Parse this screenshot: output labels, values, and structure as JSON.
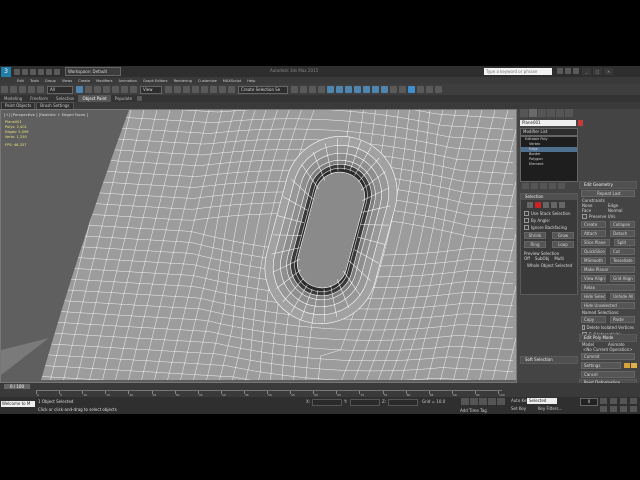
{
  "window": {
    "workspace": "Workspace: Default",
    "title": "Autodesk 3ds Max 2015",
    "help_search": "Type a keyword or phrase"
  },
  "menu": [
    "Edit",
    "Tools",
    "Group",
    "Views",
    "Create",
    "Modifiers",
    "Animation",
    "Graph Editors",
    "Rendering",
    "Customize",
    "MAXScript",
    "Help"
  ],
  "toolbar": {
    "selection_filter": "All",
    "coord_system": "View",
    "named_selection": "Create Selection Se"
  },
  "ribbon": {
    "tabs": [
      "Modeling",
      "Freeform",
      "Selection",
      "Object Paint",
      "Populate"
    ],
    "active_tab": "Object Paint",
    "sub": [
      "Paint Objects",
      "Brush Settings"
    ]
  },
  "viewport": {
    "label": "[+] [Perspective ] [Realistic + Edged Faces ]",
    "stats": {
      "header": "Plane001",
      "polys_label": "Polys:",
      "polys": "2,401",
      "edges_label": "Edges:",
      "edges": "5,096",
      "verts_label": "Verts:",
      "verts": "1,250",
      "fps_label": "FPS:",
      "fps": "46.337"
    }
  },
  "command_panel": {
    "object_name": "Plane001",
    "modifier_list": "Modifier List",
    "stack": [
      "Editable Poly",
      "Vertex",
      "Edge",
      "Border",
      "Polygon",
      "Element"
    ],
    "stack_selected": "Edge",
    "selection": {
      "title": "Selection",
      "by_vertex": "Use Stack Selection",
      "by_angle": "By Angle:",
      "ignore": "Ignore Backfacing",
      "shrink": "Shrink",
      "grow": "Grow",
      "ring": "Ring",
      "loop": "Loop",
      "preview": "Preview Selection",
      "off": "Off",
      "subobj": "SubObj",
      "multi": "Multi",
      "whole": "Whole Object Selected"
    },
    "soft_selection": "Soft Selection",
    "edit_geometry": {
      "title": "Edit Geometry",
      "repeat": "Repeat Last",
      "constraints": "Constraints",
      "none": "None",
      "edge": "Edge",
      "face": "Face",
      "normal": "Normal",
      "preserve": "Preserve UVs",
      "create": "Create",
      "collapse": "Collapse",
      "attach": "Attach",
      "detach": "Detach",
      "slice_plane": "Slice Plane",
      "split": "Split",
      "quickslice": "QuickSlice",
      "cut": "Cut",
      "msmooth": "MSmooth",
      "tessellate": "Tessellate",
      "make_planar": "Make Planar",
      "view_align": "View Align",
      "grid_align": "Grid Align",
      "relax": "Relax",
      "hide_sel": "Hide Selected",
      "unhide_all": "Unhide All",
      "hide_unsel": "Hide Unselected",
      "named_sel": "Named Selections:",
      "copy": "Copy",
      "paste": "Paste",
      "delete_iso": "Delete Isolated Vertices",
      "full_inter": "Full Interactivity"
    },
    "paint_deformation": "Paint Deformation",
    "edit_poly_mode": {
      "title": "Edit Poly Mode",
      "model": "Model",
      "animate": "Animate",
      "no_current": "<No Current Operation>",
      "commit": "Commit",
      "settings": "Settings",
      "cancel": "Cancel",
      "show_cage": "Show Cage"
    }
  },
  "timeline": {
    "slider": "0 / 100",
    "ticks": [
      "0",
      "5",
      "10",
      "15",
      "20",
      "25",
      "30",
      "35",
      "40",
      "45",
      "50",
      "55",
      "60",
      "65",
      "70",
      "75",
      "80",
      "85",
      "90",
      "95",
      "100"
    ]
  },
  "status": {
    "maxscript": "Welcome to M",
    "line1": "1 Object Selected",
    "line2": "Click or click-and-drag to select objects",
    "x_label": "X:",
    "x": "",
    "y_label": "Y:",
    "y": "",
    "z_label": "Z:",
    "z": "",
    "grid": "Grid = 10.0",
    "add_time_tag": "Add Time Tag",
    "auto_key": "Auto Key",
    "selected": "Selected",
    "set_key": "Set Key",
    "key_filters": "Key Filters...",
    "frame": "0"
  },
  "colors": {
    "viewport_bg": "#5f5f5f",
    "mesh_face": "#9b9b9b",
    "wire": "#ffffff",
    "accent_blue": "#4f86b0",
    "object_color": "#c83a3a"
  }
}
